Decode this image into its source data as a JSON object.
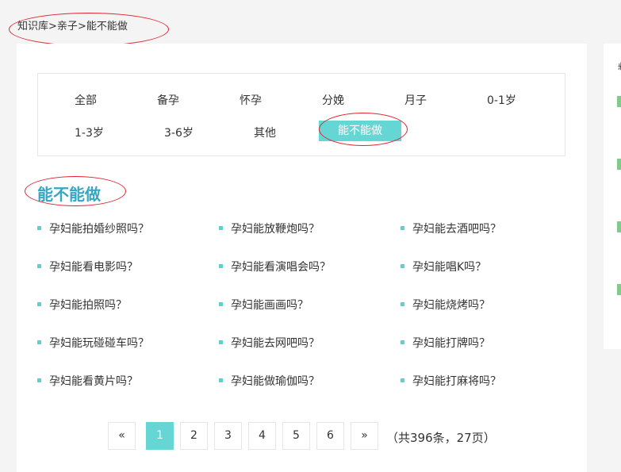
{
  "breadcrumb": {
    "root": "知识库",
    "sep1": ">",
    "parent": "亲子",
    "sep2": ">",
    "current": "能不能做"
  },
  "categories": [
    {
      "label": "全部",
      "active": false
    },
    {
      "label": "备孕",
      "active": false
    },
    {
      "label": "怀孕",
      "active": false
    },
    {
      "label": "分娩",
      "active": false
    },
    {
      "label": "月子",
      "active": false
    },
    {
      "label": "0-1岁",
      "active": false
    },
    {
      "label": "1-3岁",
      "active": false
    },
    {
      "label": "3-6岁",
      "active": false
    },
    {
      "label": "其他",
      "active": false
    },
    {
      "label": "能不能做",
      "active": true
    }
  ],
  "section_title": "能不能做",
  "questions": [
    "孕妇能拍婚纱照吗？",
    "孕妇能放鞭炮吗？",
    "孕妇能去酒吧吗？",
    "孕妇能看电影吗？",
    "孕妇能看演唱会吗？",
    "孕妇能唱K吗？",
    "孕妇能拍照吗？",
    "孕妇能画画吗？",
    "孕妇能烧烤吗？",
    "孕妇能玩碰碰车吗？",
    "孕妇能去网吧吗？",
    "孕妇能打牌吗？",
    "孕妇能看黄片吗？",
    "孕妇能做瑜伽吗？",
    "孕妇能打麻将吗？"
  ],
  "pagination": {
    "prev": "«",
    "pages": [
      "1",
      "2",
      "3",
      "4",
      "5",
      "6"
    ],
    "current": "1",
    "next": "»",
    "info": "（共396条，27页）"
  },
  "colors": {
    "accent": "#66d6d4",
    "title": "#35a7c3",
    "annotation": "#e0232f",
    "sidebar_bar": "#7ecb8c"
  }
}
